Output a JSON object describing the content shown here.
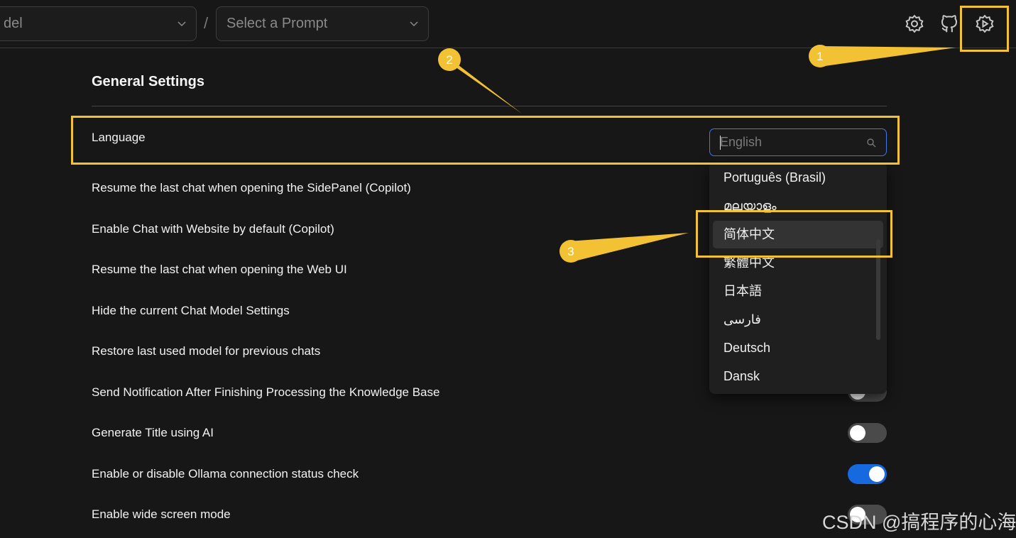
{
  "header": {
    "model_select_text": "del",
    "separator": "/",
    "prompt_select_placeholder": "Select a Prompt",
    "icons": [
      "settings-icon",
      "github-icon",
      "sidepanel-settings-icon"
    ]
  },
  "settings": {
    "section_title": "General Settings",
    "language": {
      "label": "Language",
      "placeholder": "English",
      "options": [
        "Português (Brasil)",
        "മലയാളം",
        "简体中文",
        "繁體中文",
        "日本語",
        "فارسی",
        "Deutsch",
        "Dansk"
      ],
      "highlighted_option": "简体中文"
    },
    "rows": [
      {
        "label": "Resume the last chat when opening the SidePanel (Copilot)"
      },
      {
        "label": "Enable Chat with Website by default (Copilot)"
      },
      {
        "label": "Resume the last chat when opening the Web UI"
      },
      {
        "label": "Hide the current Chat Model Settings"
      },
      {
        "label": "Restore last used model for previous chats"
      },
      {
        "label": "Send Notification After Finishing Processing the Knowledge Base",
        "enabled": false
      },
      {
        "label": "Generate Title using AI",
        "enabled": false
      },
      {
        "label": "Enable or disable Ollama connection status check",
        "enabled": true
      },
      {
        "label": "Enable wide screen mode",
        "enabled": false
      }
    ]
  },
  "annotations": {
    "callout_1": "1",
    "callout_2": "2",
    "callout_3": "3"
  },
  "watermark": "CSDN @搞程序的心海",
  "colors": {
    "annotation": "#f3c134",
    "toggle_on": "#1769e0",
    "focus_border": "#3b7ae8",
    "background": "#171717"
  }
}
